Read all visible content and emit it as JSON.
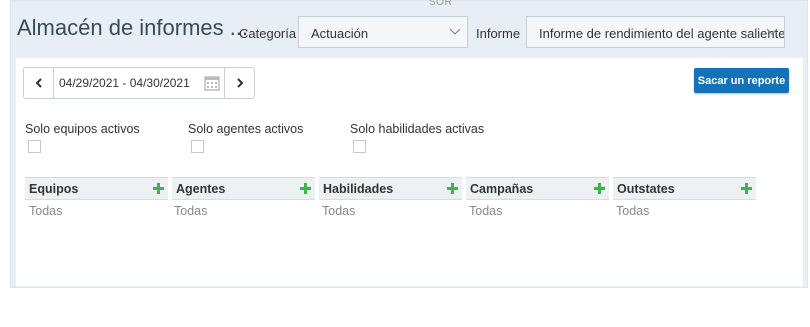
{
  "header": {
    "title": "Almacén de informes ...",
    "cut_label": "SOR",
    "category_label": "Categoría",
    "category_value": "Actuación",
    "report_label": "Informe",
    "report_value": "Informe de rendimiento del agente saliente"
  },
  "toolbar": {
    "date_range": "04/29/2021 - 04/30/2021",
    "report_button": "Sacar un reporte"
  },
  "filters": {
    "active_teams": "Solo equipos activos",
    "active_agents": "Solo agentes activos",
    "active_skills": "Solo habilidades activas"
  },
  "columns": [
    {
      "title": "Equipos",
      "value": "Todas"
    },
    {
      "title": "Agentes",
      "value": "Todas"
    },
    {
      "title": "Habilidades",
      "value": "Todas"
    },
    {
      "title": "Campañas",
      "value": "Todas"
    },
    {
      "title": "Outstates",
      "value": "Todas"
    }
  ],
  "colors": {
    "accent": "#1473b8",
    "plus": "#3bb54a",
    "background": "#e8eef5"
  },
  "icons": {
    "prev": "chevron-left-icon",
    "next": "chevron-right-icon",
    "calendar": "calendar-icon",
    "add": "plus-icon",
    "dropdown": "chevron-down-icon"
  }
}
